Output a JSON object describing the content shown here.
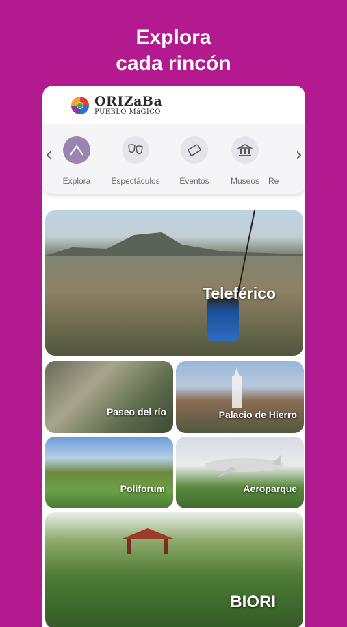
{
  "headline": {
    "line1": "Explora",
    "line2": "cada rincón"
  },
  "app": {
    "logo": {
      "word1": "ORIZaBa",
      "word2": "PUEBLO MáGICO"
    }
  },
  "categories": [
    {
      "label": "Explora",
      "icon": "mountain-icon",
      "active": true
    },
    {
      "label": "Espectáculos",
      "icon": "theater-masks-icon",
      "active": false
    },
    {
      "label": "Eventos",
      "icon": "ticket-icon",
      "active": false
    },
    {
      "label": "Museos",
      "icon": "museum-icon",
      "active": false
    },
    {
      "label": "Re",
      "icon": "",
      "active": false
    }
  ],
  "tiles": [
    {
      "label": "Teleférico"
    },
    {
      "label": "Paseo del río"
    },
    {
      "label": "Palacio de Hierro"
    },
    {
      "label": "Poliforum"
    },
    {
      "label": "Aeroparque"
    },
    {
      "label": "BIORI"
    }
  ],
  "colors": {
    "background": "#b41a8f",
    "active_category": "#9b85b0"
  }
}
